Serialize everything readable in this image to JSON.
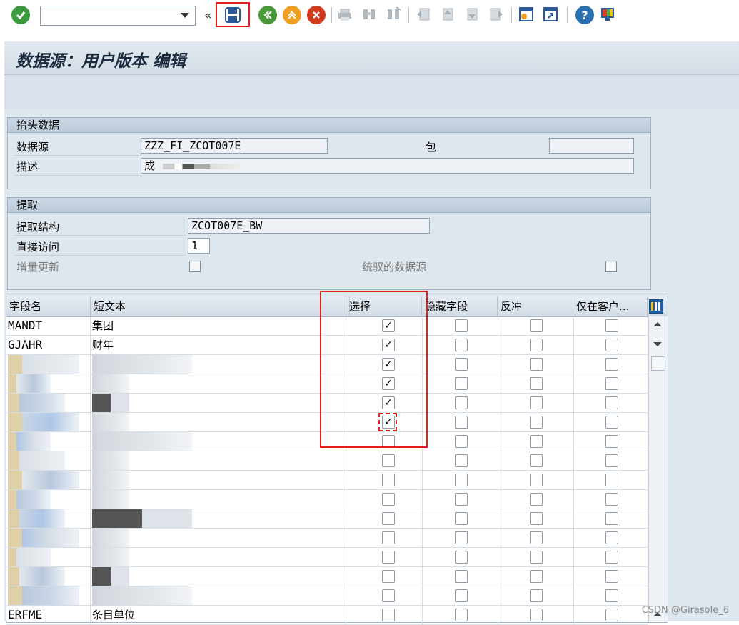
{
  "toolbar": {
    "command_field_value": "",
    "icons": [
      "enter-icon",
      "command-field",
      "back-arrow-icon",
      "save-icon",
      "back-icon",
      "exit-icon",
      "cancel-icon",
      "print-icon",
      "find-icon",
      "find-next-icon",
      "first-page-icon",
      "previous-page-icon",
      "next-page-icon",
      "last-page-icon",
      "create-session-icon",
      "shortcut-icon",
      "help-icon",
      "layout-icon"
    ]
  },
  "title": "数据源：用户版本 编辑",
  "header_group": {
    "title": "抬头数据",
    "datasource_label": "数据源",
    "datasource_value": "ZZZ_FI_ZCOT007E",
    "package_label": "包",
    "package_value": "",
    "description_label": "描述",
    "description_value": "成"
  },
  "extract_group": {
    "title": "提取",
    "structure_label": "提取结构",
    "structure_value": "ZCOT007E_BW",
    "direct_access_label": "直接访问",
    "direct_access_value": "1",
    "delta_label": "增量更新",
    "delta_checked": false,
    "generic_label": "统驭的数据源",
    "generic_checked": false
  },
  "table": {
    "columns": [
      "字段名",
      "短文本",
      "",
      "选择",
      "隐藏字段",
      "反冲",
      "仅在客户..."
    ],
    "rows": [
      {
        "field": "MANDT",
        "text": "集团",
        "select": true,
        "hide": false,
        "inversion": false,
        "client": false
      },
      {
        "field": "GJAHR",
        "text": "财年",
        "select": true,
        "hide": false,
        "inversion": false,
        "client": false
      },
      {
        "field": "",
        "text": "",
        "select": true,
        "hide": false,
        "inversion": false,
        "client": false
      },
      {
        "field": "",
        "text": "",
        "select": true,
        "hide": false,
        "inversion": false,
        "client": false
      },
      {
        "field": "",
        "text": "",
        "select": true,
        "hide": false,
        "inversion": false,
        "client": false
      },
      {
        "field": "",
        "text": "",
        "select": true,
        "hide": false,
        "inversion": false,
        "client": false
      },
      {
        "field": "",
        "text": "",
        "select": false,
        "hide": false,
        "inversion": false,
        "client": false
      },
      {
        "field": "",
        "text": "",
        "select": false,
        "hide": false,
        "inversion": false,
        "client": false
      },
      {
        "field": "",
        "text": "",
        "select": false,
        "hide": false,
        "inversion": false,
        "client": false
      },
      {
        "field": "",
        "text": "",
        "select": false,
        "hide": false,
        "inversion": false,
        "client": false
      },
      {
        "field": "",
        "text": "",
        "select": false,
        "hide": false,
        "inversion": false,
        "client": false
      },
      {
        "field": "",
        "text": "",
        "select": false,
        "hide": false,
        "inversion": false,
        "client": false
      },
      {
        "field": "",
        "text": "",
        "select": false,
        "hide": false,
        "inversion": false,
        "client": false
      },
      {
        "field": "",
        "text": "",
        "select": false,
        "hide": false,
        "inversion": false,
        "client": false
      },
      {
        "field": "",
        "text": "",
        "select": false,
        "hide": false,
        "inversion": false,
        "client": false
      },
      {
        "field": "ERFME",
        "text": "条目单位",
        "select": false,
        "hide": false,
        "inversion": false,
        "client": false
      }
    ]
  },
  "watermark": "CSDN @Girasole_6",
  "colors": {
    "highlight_red": "#e02020",
    "enter_green": "#3c9a3c",
    "cancel_red": "#d23a1e"
  }
}
